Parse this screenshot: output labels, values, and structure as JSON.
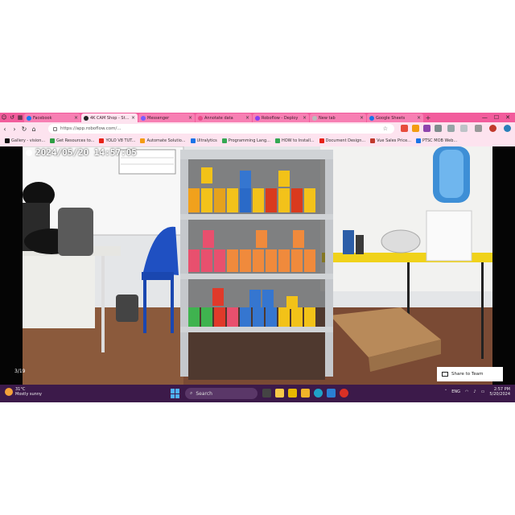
{
  "browser": {
    "tabs": [
      {
        "label": "Facebook",
        "favicon_color": "#1877f2",
        "active": false
      },
      {
        "label": "4K CAM Shop - Stores",
        "favicon_color": "#222222",
        "active": true
      },
      {
        "label": "Messenger",
        "favicon_color": "#7b5cff",
        "active": false
      },
      {
        "label": "Annotate data",
        "favicon_color": "#e94c89",
        "active": false
      },
      {
        "label": "Roboflow - Deploy",
        "favicon_color": "#8a3ff0",
        "active": false
      },
      {
        "label": "New tab",
        "favicon_color": "#bbbbbb",
        "active": false
      },
      {
        "label": "Google Sheets",
        "favicon_color": "#1a73e8",
        "active": false
      }
    ],
    "url": "https://app.roboflow.com/...",
    "bookmarks": [
      {
        "label": "Gallery - vision...",
        "icon_color": "#111111"
      },
      {
        "label": "Get Resources to...",
        "icon_color": "#2e9e44"
      },
      {
        "label": "YOLO V8 TUT...",
        "icon_color": "#e62117"
      },
      {
        "label": "Automate Solutio...",
        "icon_color": "#f39c12"
      },
      {
        "label": "Ultralytics",
        "icon_color": "#1a73e8"
      },
      {
        "label": "Programming Lang...",
        "icon_color": "#34a853"
      },
      {
        "label": "HOW to Install...",
        "icon_color": "#34a853"
      },
      {
        "label": "Document Design...",
        "icon_color": "#e62117"
      },
      {
        "label": "Vue Sales Price...",
        "icon_color": "#c0392b"
      },
      {
        "label": "PTSC MOB Web...",
        "icon_color": "#1a73e8"
      }
    ]
  },
  "viewer": {
    "timestamp": "2024/05/20  14:57:05",
    "counter": "3/19",
    "overlay_button": "Share to Team"
  },
  "taskbar": {
    "weather_temp": "31°C",
    "weather_desc": "Mostly sunny",
    "search_placeholder": "Search",
    "language": "ENG",
    "time": "2:57 PM",
    "date": "5/20/2024"
  }
}
